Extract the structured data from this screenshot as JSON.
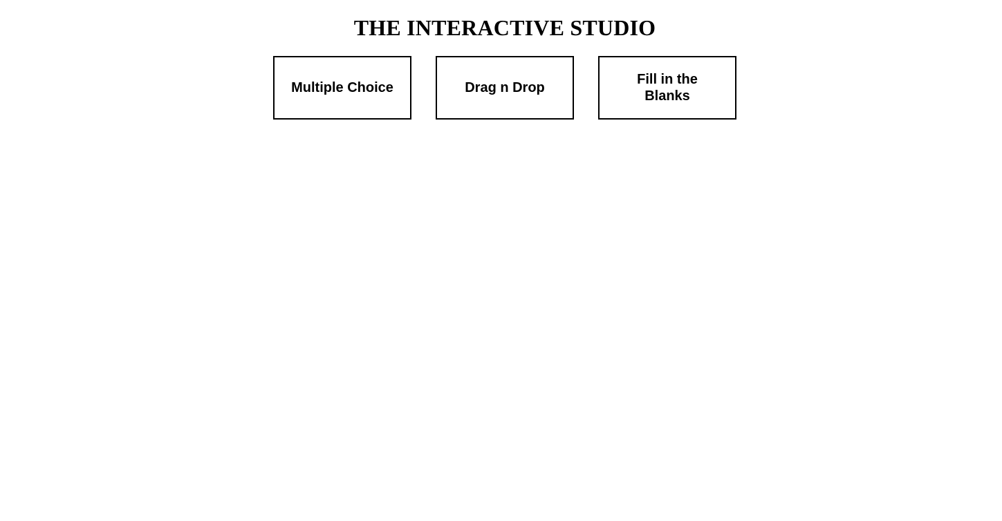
{
  "page": {
    "title": "THE INTERACTIVE STUDIO"
  },
  "options": [
    {
      "label": "Multiple Choice"
    },
    {
      "label": "Drag n Drop"
    },
    {
      "label": "Fill in the Blanks"
    }
  ],
  "colors": {
    "background": "#ffffff",
    "text": "#000000",
    "border": "#000000"
  }
}
